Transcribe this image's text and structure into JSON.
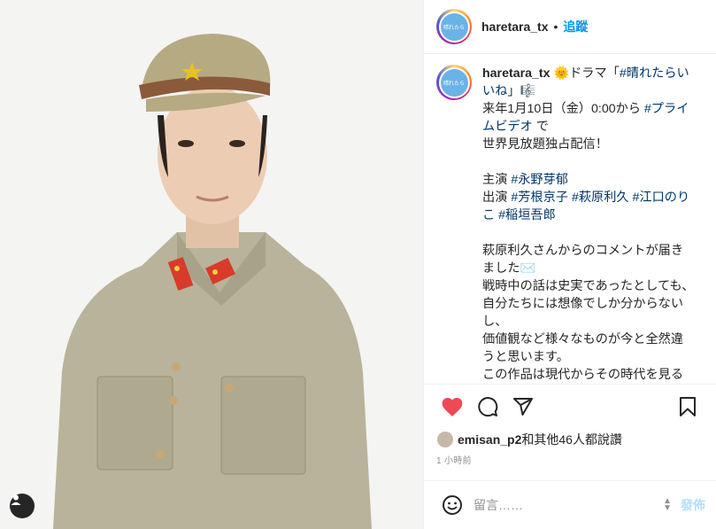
{
  "colors": {
    "accent": "#0095f6",
    "like": "#ed4956",
    "hashtag": "#00376b"
  },
  "header": {
    "username": "haretara_tx",
    "separator": "•",
    "follow_label": "追蹤",
    "avatar_text": "晴れたら"
  },
  "caption": {
    "username": "haretara_tx",
    "lines": [
      {
        "t": "🌞ドラマ「"
      },
      {
        "tag": "#晴れたらいいね"
      },
      {
        "t": "」🎼"
      },
      {
        "br": true
      },
      {
        "t": "来年1月10日（金）0:00から "
      },
      {
        "tag": "#プライムビデオ"
      },
      {
        "t": " で"
      },
      {
        "br": true
      },
      {
        "t": "世界見放題独占配信！"
      }
    ],
    "cast_main_label": "主演 ",
    "cast_main": "#永野芽郁",
    "cast_label": "出演 ",
    "cast": [
      "#芳根京子",
      "#萩原利久",
      "#江口のりこ",
      "#稲垣吾郎"
    ],
    "comment_lines": [
      "萩原利久さんからのコメントが届きました✉️",
      "戦時中の話は史実であったとしても、",
      "自分たちには想像でしか分からないし、",
      "価値観など様々なものが今と全然違うと思います。",
      "この作品は現代からその時代を見るという視点があるので、"
    ]
  },
  "actions": {
    "like_icon": "heart-filled-icon",
    "comment_icon": "comment-icon",
    "share_icon": "share-icon",
    "save_icon": "bookmark-icon"
  },
  "likes": {
    "username": "emisan_p2",
    "text": "和其他46人都說讚"
  },
  "time": "1 小時前",
  "comment_box": {
    "placeholder": "留言……",
    "post_label": "發佈"
  }
}
